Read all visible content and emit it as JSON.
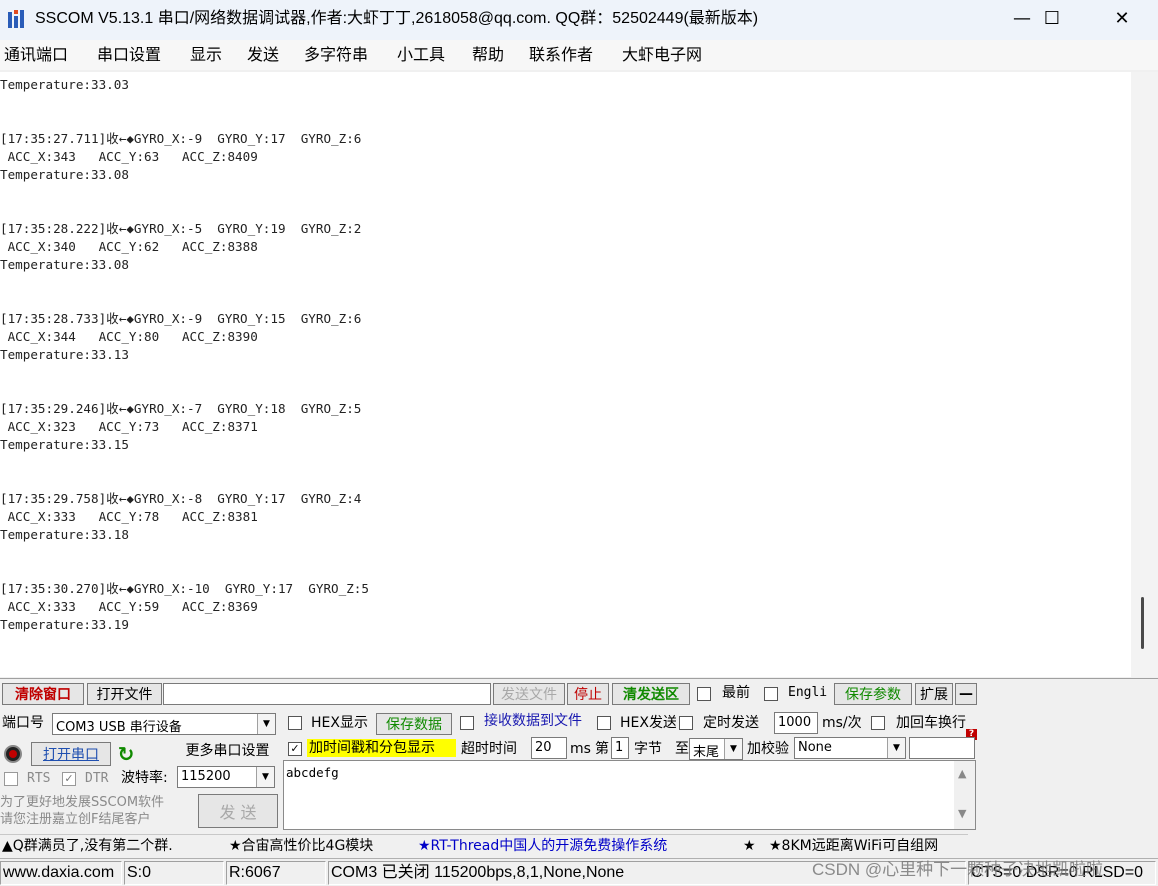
{
  "window": {
    "title": "SSCOM V5.13.1 串口/网络数据调试器,作者:大虾丁丁,2618058@qq.com. QQ群：52502449(最新版本)",
    "minimize": "—",
    "maximize": "☐",
    "close": "✕"
  },
  "menu": [
    "通讯端口",
    "串口设置",
    "显示",
    "发送",
    "多字符串",
    "小工具",
    "帮助",
    "联系作者",
    "大虾电子网"
  ],
  "output_lines": [
    "Temperature:33.03",
    "",
    "",
    "[17:35:27.711]收←◆GYRO_X:-9  GYRO_Y:17  GYRO_Z:6",
    " ACC_X:343   ACC_Y:63   ACC_Z:8409",
    "Temperature:33.08",
    "",
    "",
    "[17:35:28.222]收←◆GYRO_X:-5  GYRO_Y:19  GYRO_Z:2",
    " ACC_X:340   ACC_Y:62   ACC_Z:8388",
    "Temperature:33.08",
    "",
    "",
    "[17:35:28.733]收←◆GYRO_X:-9  GYRO_Y:15  GYRO_Z:6",
    " ACC_X:344   ACC_Y:80   ACC_Z:8390",
    "Temperature:33.13",
    "",
    "",
    "[17:35:29.246]收←◆GYRO_X:-7  GYRO_Y:18  GYRO_Z:5",
    " ACC_X:323   ACC_Y:73   ACC_Z:8371",
    "Temperature:33.15",
    "",
    "",
    "[17:35:29.758]收←◆GYRO_X:-8  GYRO_Y:17  GYRO_Z:4",
    " ACC_X:333   ACC_Y:78   ACC_Z:8381",
    "Temperature:33.18",
    "",
    "",
    "[17:35:30.270]收←◆GYRO_X:-10  GYRO_Y:17  GYRO_Z:5",
    " ACC_X:333   ACC_Y:59   ACC_Z:8369",
    "Temperature:33.19"
  ],
  "toolbar": {
    "clear_window": "清除窗口",
    "open_file": "打开文件",
    "file_path": "",
    "send_file": "发送文件",
    "stop": "停止",
    "clear_send": "清发送区",
    "topmost": "最前",
    "english": "Engli",
    "save_params": "保存参数",
    "expand": "扩展",
    "collapse": "—"
  },
  "port": {
    "port_label": "端口号",
    "port_value": "COM3 USB 串行设备",
    "open_port": "打开串口",
    "more_settings": "更多串口设置",
    "rts": "RTS",
    "dtr": "DTR",
    "baud_label": "波特率:",
    "baud_value": "115200",
    "promo_line1": "为了更好地发展SSCOM软件",
    "promo_line2": "请您注册嘉立创F结尾客户"
  },
  "options": {
    "hex_display": "HEX显示",
    "save_data": "保存数据",
    "recv_to_file": "接收数据到文件",
    "hex_send": "HEX发送",
    "timed_send": "定时发送",
    "interval_value": "1000",
    "interval_unit": "ms/次",
    "append_crlf": "加回车换行",
    "timestamp": "加时间戳和分包显示",
    "timeout_label": "超时时间",
    "timeout_value": "20",
    "timeout_unit": "ms",
    "byte_from_label": "第",
    "byte_from_value": "1",
    "byte_unit": "字节",
    "byte_to_label": "至",
    "byte_to_value": "末尾",
    "checksum_label": "加校验",
    "checksum_value": "None",
    "send_button": "发 送",
    "help_badge": "?"
  },
  "send_text": "abcdefg",
  "ads": [
    "▲Q群满员了,没有第二个群.",
    "★合宙高性价比4G模块",
    "★RT-Thread中国人的开源免费操作系统",
    "★",
    "★8KM远距离WiFi可自组网"
  ],
  "status": {
    "website": "www.daxia.com",
    "sent": "S:0",
    "received": "R:6067",
    "port_state": "COM3 已关闭  115200bps,8,1,None,None",
    "signals": "CTS=0 DSR=0 RLSD=0",
    "watermark": "CSDN @心里种下一颗种子决地凯啦啦"
  },
  "colors": {
    "accent_red": "#c00000",
    "accent_green": "#108a00",
    "ad_blue": "#0000c8",
    "highlight_yellow": "#ffff00"
  }
}
